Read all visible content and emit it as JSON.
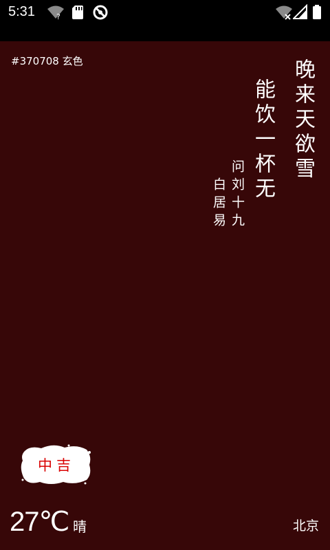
{
  "status_bar": {
    "time": "5:31",
    "left_icons": [
      "wifi-question-icon",
      "sd-card-icon",
      "no-sync-icon"
    ],
    "right_icons": [
      "wifi-off-icon",
      "signal-icon",
      "battery-icon"
    ]
  },
  "color": {
    "code": "#370708 玄色",
    "background_hex": "#370708"
  },
  "poem": {
    "line1": "晚来天欲雪",
    "line2": "能饮一杯无",
    "title": "问刘十九",
    "author": "白居易"
  },
  "fortune": {
    "text": "中吉",
    "text_color": "#d90000"
  },
  "weather": {
    "temperature": "27℃",
    "condition": "晴",
    "city": "北京"
  }
}
